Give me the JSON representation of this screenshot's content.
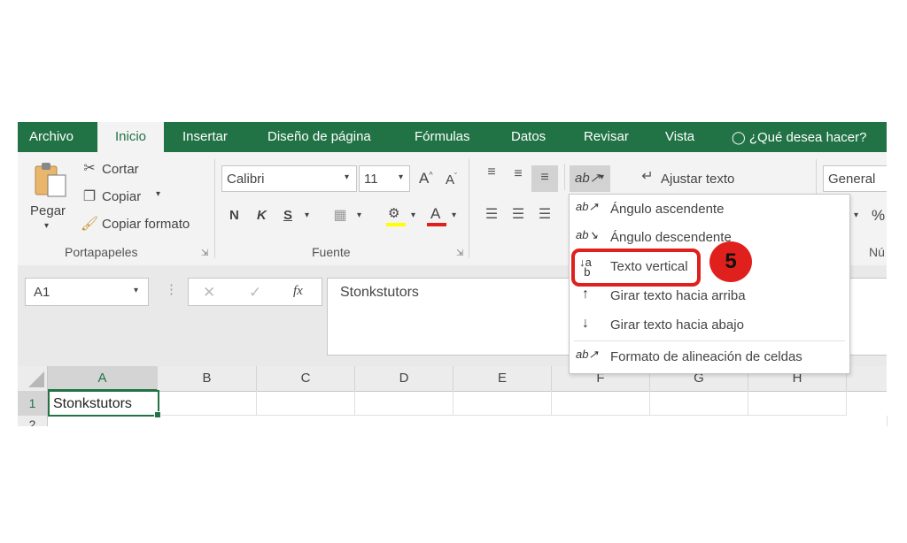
{
  "menubar": {
    "tabs": [
      {
        "label": "Archivo"
      },
      {
        "label": "Inicio"
      },
      {
        "label": "Insertar"
      },
      {
        "label": "Diseño de página"
      },
      {
        "label": "Fórmulas"
      },
      {
        "label": "Datos"
      },
      {
        "label": "Revisar"
      },
      {
        "label": "Vista"
      }
    ],
    "tell_me": "¿Qué desea hacer?"
  },
  "clipboard": {
    "paste": "Pegar",
    "cut": "Cortar",
    "copy": "Copiar",
    "format_painter": "Copiar formato",
    "group_label": "Portapapeles"
  },
  "font": {
    "name": "Calibri",
    "size": "11",
    "bold": "N",
    "italic": "K",
    "underline": "S",
    "group_label": "Fuente",
    "font_color": "#e0201c",
    "highlight_color": "#ffff00"
  },
  "alignment": {
    "wrap_text": "Ajustar texto"
  },
  "number": {
    "format": "General",
    "percent": "%",
    "group_label": "Nú"
  },
  "orientation_menu": {
    "items": [
      {
        "label": "Ángulo ascendente"
      },
      {
        "label": "Ángulo descendente"
      },
      {
        "label": "Texto vertical"
      },
      {
        "label": "Girar texto hacia arriba"
      },
      {
        "label": "Girar texto hacia abajo"
      },
      {
        "label": "Formato de alineación de celdas"
      }
    ]
  },
  "step_badge": "5",
  "formula_bar": {
    "name_box": "A1",
    "fx": "fx",
    "value": "Stonkstutors"
  },
  "grid": {
    "columns": [
      "A",
      "B",
      "C",
      "D",
      "E",
      "F",
      "G",
      "H"
    ],
    "rows": [
      "1",
      "2"
    ],
    "a1": "Stonkstutors"
  },
  "colors": {
    "excel_green": "#217346",
    "highlight_red": "#e0201c"
  }
}
